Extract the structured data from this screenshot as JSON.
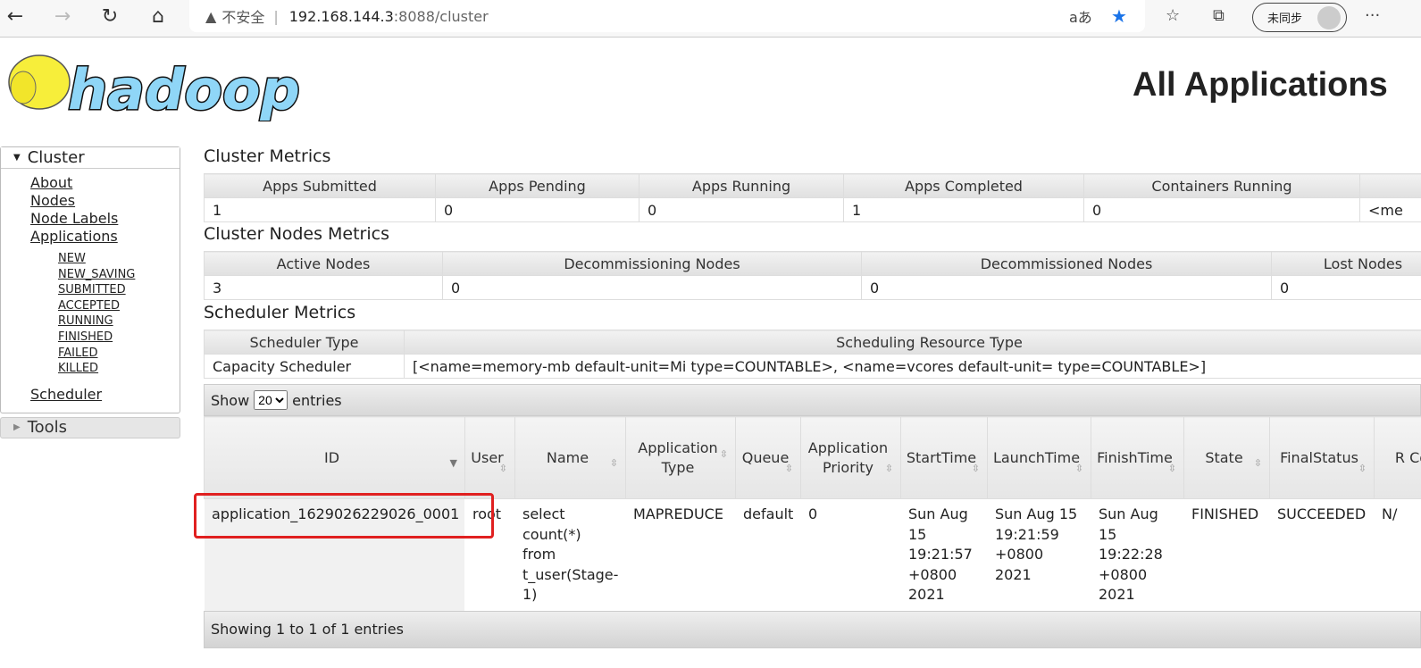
{
  "browser": {
    "security_label": "不安全",
    "url_host": "192.168.144.3",
    "url_rest": ":8088/cluster",
    "sync_label": "未同步",
    "icons": [
      "back-icon",
      "forward-icon",
      "refresh-icon",
      "home-icon",
      "warning-icon",
      "read-aloud-icon",
      "favorite-star-icon",
      "favorites-icon",
      "collections-icon",
      "more-icon"
    ]
  },
  "logo_text": "hadoop",
  "page_title": "All Applications",
  "sidebar": {
    "cluster_label": "Cluster",
    "links": [
      "About",
      "Nodes",
      "Node Labels",
      "Applications"
    ],
    "states": [
      "NEW",
      "NEW_SAVING",
      "SUBMITTED",
      "ACCEPTED",
      "RUNNING",
      "FINISHED",
      "FAILED",
      "KILLED"
    ],
    "scheduler": "Scheduler",
    "tools_label": "Tools"
  },
  "cluster_metrics": {
    "title": "Cluster Metrics",
    "headers": [
      "Apps Submitted",
      "Apps Pending",
      "Apps Running",
      "Apps Completed",
      "Containers Running",
      ""
    ],
    "values": [
      "1",
      "0",
      "0",
      "1",
      "0",
      "<me"
    ]
  },
  "nodes_metrics": {
    "title": "Cluster Nodes Metrics",
    "headers": [
      "Active Nodes",
      "Decommissioning Nodes",
      "Decommissioned Nodes",
      "Lost Nodes"
    ],
    "values": [
      "3",
      "0",
      "0",
      "0"
    ]
  },
  "scheduler_metrics": {
    "title": "Scheduler Metrics",
    "headers": [
      "Scheduler Type",
      "Scheduling Resource Type"
    ],
    "values": [
      "Capacity Scheduler",
      "[<name=memory-mb default-unit=Mi type=COUNTABLE>, <name=vcores default-unit= type=COUNTABLE>]"
    ]
  },
  "apps": {
    "show_label": "Show",
    "entries_value": "20",
    "entries_label": "entries",
    "headers": [
      "ID",
      "User",
      "Name",
      "Application Type",
      "Queue",
      "Application Priority",
      "StartTime",
      "LaunchTime",
      "FinishTime",
      "State",
      "FinalStatus",
      "R Co"
    ],
    "rows": [
      [
        "application_1629026229026_0001",
        "root",
        "select count(*) from t_user(Stage-1)",
        "MAPREDUCE",
        "default",
        "0",
        "Sun Aug 15 19:21:57 +0800 2021",
        "Sun Aug 15 19:21:59 +0800 2021",
        "Sun Aug 15 19:22:28 +0800 2021",
        "FINISHED",
        "SUCCEEDED",
        "N/"
      ]
    ],
    "footer": "Showing 1 to 1 of 1 entries",
    "highlight_color": "#e02020"
  }
}
